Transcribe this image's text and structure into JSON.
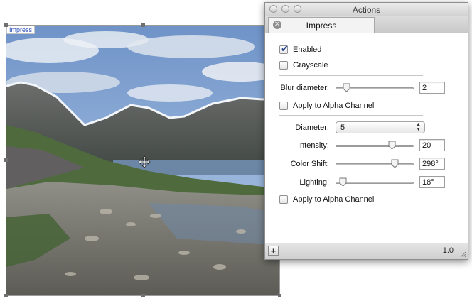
{
  "canvas": {
    "layer_tag": "Impress"
  },
  "window": {
    "title": "Actions",
    "tab_label": "Impress",
    "enabled_label": "Enabled",
    "enabled_checked": true,
    "grayscale_label": "Grayscale",
    "grayscale_checked": false,
    "blur_diameter_label": "Blur diameter:",
    "blur_diameter_value": "2",
    "apply_alpha_1_label": "Apply to Alpha Channel",
    "diameter_label": "Diameter:",
    "diameter_value": "5",
    "intensity_label": "Intensity:",
    "intensity_value": "20",
    "color_shift_label": "Color Shift:",
    "color_shift_value": "298°",
    "lighting_label": "Lighting:",
    "lighting_value": "18°",
    "apply_alpha_2_label": "Apply to Alpha Channel",
    "add_button_label": "+",
    "version": "1.0"
  },
  "slider_levels": {
    "blur_diameter": 0.1,
    "intensity": 0.75,
    "color_shift": 0.79,
    "lighting": 0.05
  },
  "icons": [
    "close-icon",
    "add-icon",
    "resize-grip-icon",
    "move-cursor-icon",
    "popup-arrows-icon"
  ]
}
